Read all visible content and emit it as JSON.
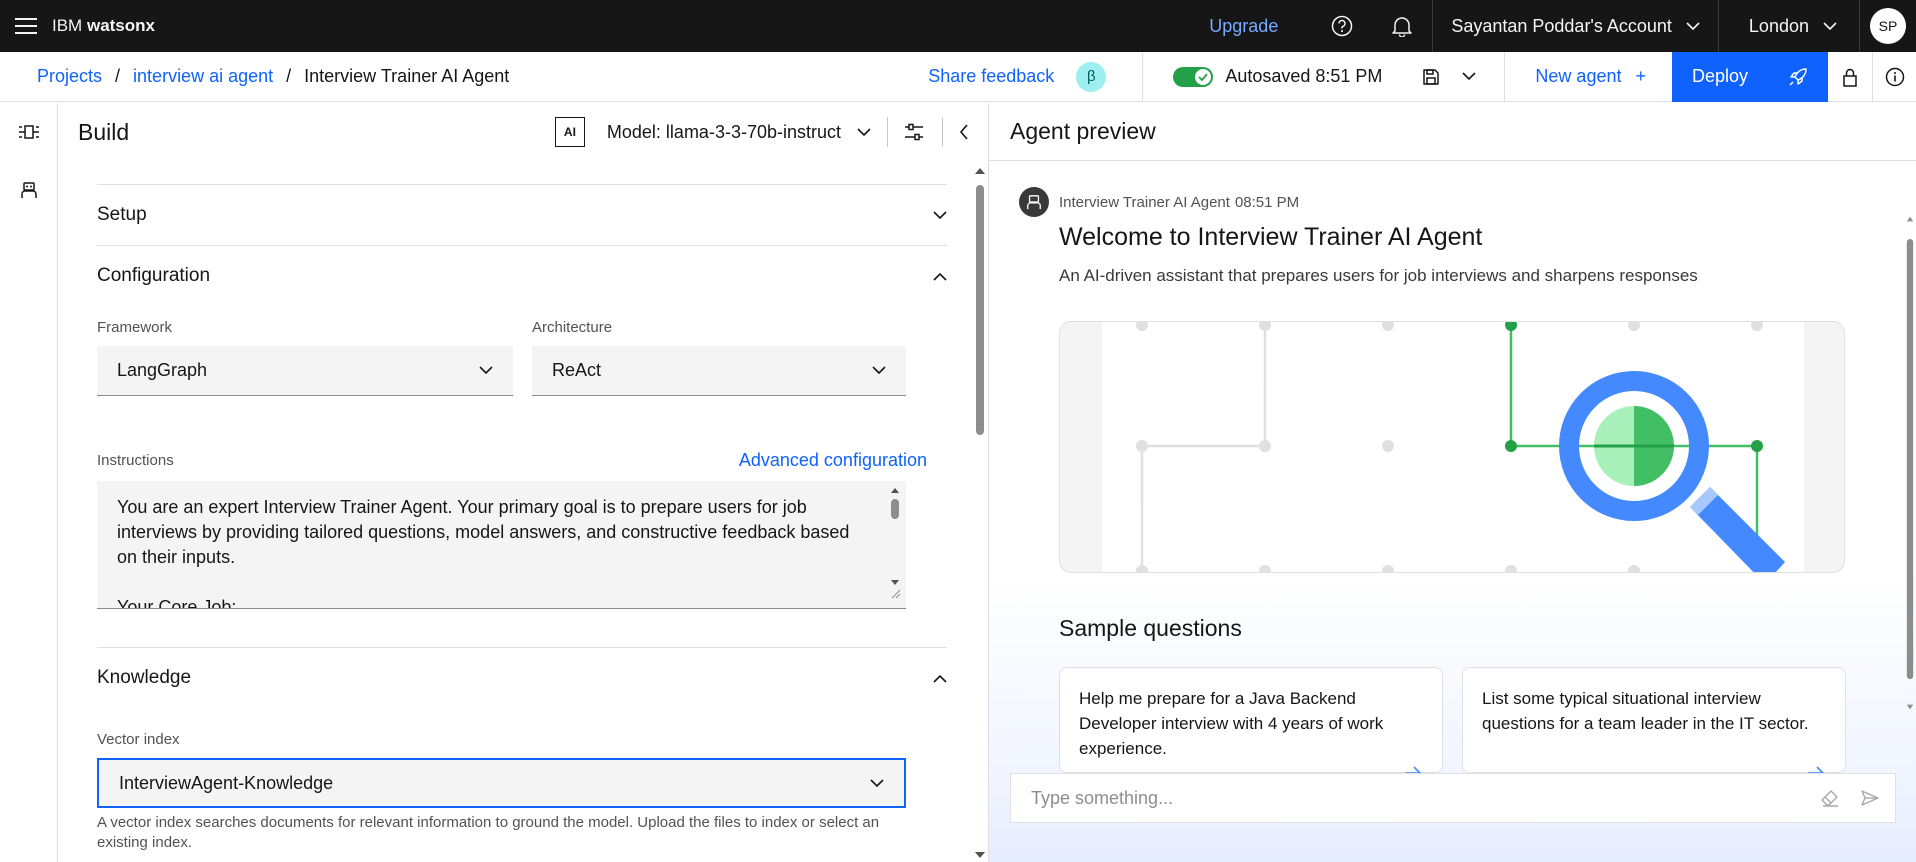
{
  "header": {
    "brand_prefix": "IBM",
    "brand_name": "watsonx",
    "upgrade_label": "Upgrade",
    "account_label": "Sayantan Poddar's Account",
    "region_label": "London",
    "avatar_initials": "SP"
  },
  "subbar": {
    "breadcrumb": [
      "Projects",
      "interview ai agent",
      "Interview Trainer AI Agent"
    ],
    "separator": "/",
    "share_feedback": "Share feedback",
    "beta_symbol": "β",
    "autosave_label": "Autosaved 8:51 PM",
    "new_agent_label": "New agent",
    "new_agent_plus": "+",
    "deploy_label": "Deploy"
  },
  "build": {
    "title": "Build",
    "ai_badge": "AI",
    "model_label": "Model: llama-3-3-70b-instruct",
    "sections": {
      "setup": "Setup",
      "configuration": "Configuration",
      "knowledge": "Knowledge"
    },
    "framework": {
      "label": "Framework",
      "value": "LangGraph"
    },
    "architecture": {
      "label": "Architecture",
      "value": "ReAct"
    },
    "instructions": {
      "label": "Instructions",
      "advanced_link": "Advanced configuration",
      "text_lines": [
        "You are an expert Interview Trainer Agent. Your primary goal is to prepare users for job",
        "interviews by providing tailored questions, model answers, and constructive feedback based",
        "on their inputs.",
        "",
        "Your Core Job:"
      ]
    },
    "vector_index": {
      "label": "Vector index",
      "value": "InterviewAgent-Knowledge",
      "helper": "A vector index searches documents for relevant information to ground the model. Upload the files to index or select an existing index."
    }
  },
  "preview": {
    "title": "Agent preview",
    "sender": "Interview Trainer AI Agent",
    "time": "08:51 PM",
    "welcome_title": "Welcome to Interview Trainer AI Agent",
    "welcome_sub": "An AI-driven assistant that prepares users for job interviews and sharpens responses",
    "sample_title": "Sample questions",
    "samples": [
      "Help me prepare for a Java Backend Developer interview with 4 years of work experience.",
      "List some typical situational interview questions for a team leader in the IT sector."
    ],
    "input_placeholder": "Type something..."
  },
  "colors": {
    "accent": "#0f62fe",
    "success": "#24a148",
    "header_bg": "#161616",
    "illustration_green": "#42be65",
    "illustration_blue": "#4589ff"
  },
  "icons": [
    "menu-icon",
    "help-icon",
    "notification-icon",
    "chevron-down-icon",
    "save-icon",
    "rocket-icon",
    "lock-icon",
    "info-icon",
    "settings-sliders-icon",
    "collapse-icon",
    "flow-icon",
    "agent-icon",
    "chevron-up-icon",
    "arrow-right-icon",
    "eraser-icon",
    "send-icon"
  ]
}
